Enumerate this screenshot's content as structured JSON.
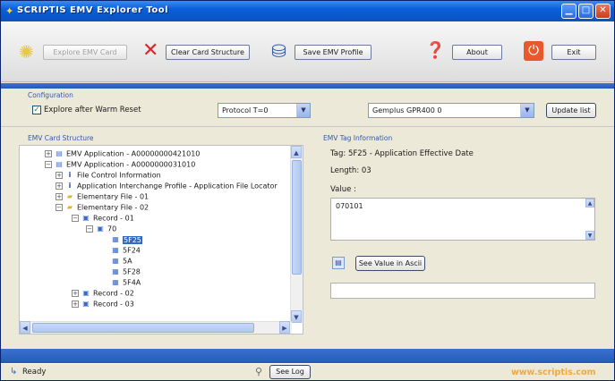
{
  "window": {
    "title": "SCRIPTIS EMV Explorer Tool",
    "accent": "#0a5fd8"
  },
  "toolbar": {
    "explore_label": "Explore EMV Card",
    "clear_label": "Clear Card Structure",
    "save_label": "Save EMV Profile",
    "about_label": "About",
    "exit_label": "Exit"
  },
  "config": {
    "section_label": "Configuration",
    "explore_after_reset_label": "Explore after Warm Reset",
    "explore_after_reset_checked": true,
    "protocol_value": "Protocol T=0",
    "reader_value": "Gemplus GPR400 0",
    "update_list_label": "Update list"
  },
  "tree": {
    "section_label": "EMV Card Structure",
    "nodes": [
      {
        "label": "EMV Application - A00000000421010",
        "icon": "card-icon"
      },
      {
        "label": "EMV Application - A0000000031010",
        "icon": "card-icon"
      },
      {
        "label": "File Control Information",
        "icon": "info-icon"
      },
      {
        "label": "Application Interchange Profile - Application File Locator",
        "icon": "info-icon"
      },
      {
        "label": "Elementary File - 01",
        "icon": "folder-icon"
      },
      {
        "label": "Elementary File - 02",
        "icon": "folder-icon"
      },
      {
        "label": "Record - 01",
        "icon": "record-icon"
      },
      {
        "label": "70",
        "icon": "record-icon"
      },
      {
        "label": "5F25",
        "icon": "tag-icon",
        "selected": true
      },
      {
        "label": "5F24",
        "icon": "tag-icon"
      },
      {
        "label": "5A",
        "icon": "tag-icon"
      },
      {
        "label": "5F28",
        "icon": "tag-icon"
      },
      {
        "label": "5F4A",
        "icon": "tag-icon"
      },
      {
        "label": "Record - 02",
        "icon": "record-icon"
      },
      {
        "label": "Record - 03",
        "icon": "record-icon"
      }
    ]
  },
  "tag_info": {
    "section_label": "EMV Tag Information",
    "tag_line": "Tag: 5F25 - Application Effective Date",
    "length_line": "Length: 03",
    "value_label": "Value :",
    "value": "070101",
    "see_ascii_label": "See Value in Ascii",
    "ascii_value": ""
  },
  "status": {
    "ready_label": "Ready",
    "see_log_label": "See Log",
    "website": "www.scriptis.com"
  }
}
